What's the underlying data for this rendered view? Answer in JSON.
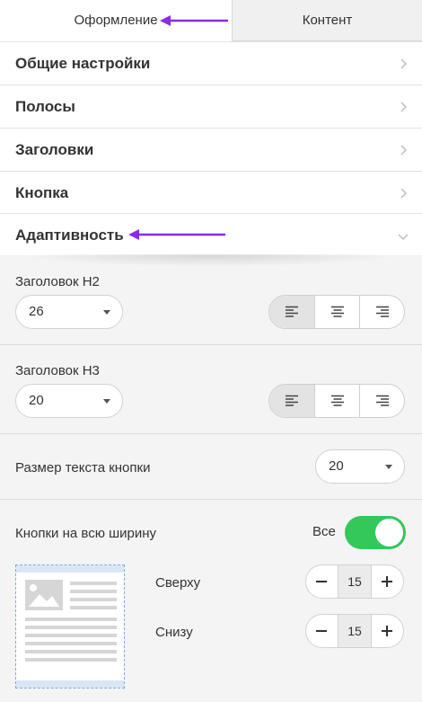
{
  "tabs": [
    {
      "label": "Оформление",
      "active": true
    },
    {
      "label": "Контент",
      "active": false
    }
  ],
  "sections": [
    {
      "label": "Общие настройки",
      "icon": "chevron-right-icon"
    },
    {
      "label": "Полосы",
      "icon": "chevron-right-icon"
    },
    {
      "label": "Заголовки",
      "icon": "chevron-right-icon"
    },
    {
      "label": "Кнопка",
      "icon": "chevron-right-icon"
    },
    {
      "label": "Адаптивность",
      "icon": "chevron-down-icon",
      "expanded": true
    }
  ],
  "adaptive": {
    "h2": {
      "label": "Заголовок H2",
      "size": "26",
      "align": "left"
    },
    "h3": {
      "label": "Заголовок H3",
      "size": "20",
      "align": "left"
    },
    "button_text": {
      "label": "Размер текста кнопки",
      "size": "20"
    },
    "full_width": {
      "label": "Кнопки на всю ширину",
      "value_label": "Все",
      "enabled": true
    },
    "padding": {
      "top": {
        "label": "Сверху",
        "value": "15"
      },
      "bottom": {
        "label": "Снизу",
        "value": "15"
      }
    }
  },
  "colors": {
    "toggle_on": "#34c759",
    "annotation_arrow": "#8a2be2"
  }
}
